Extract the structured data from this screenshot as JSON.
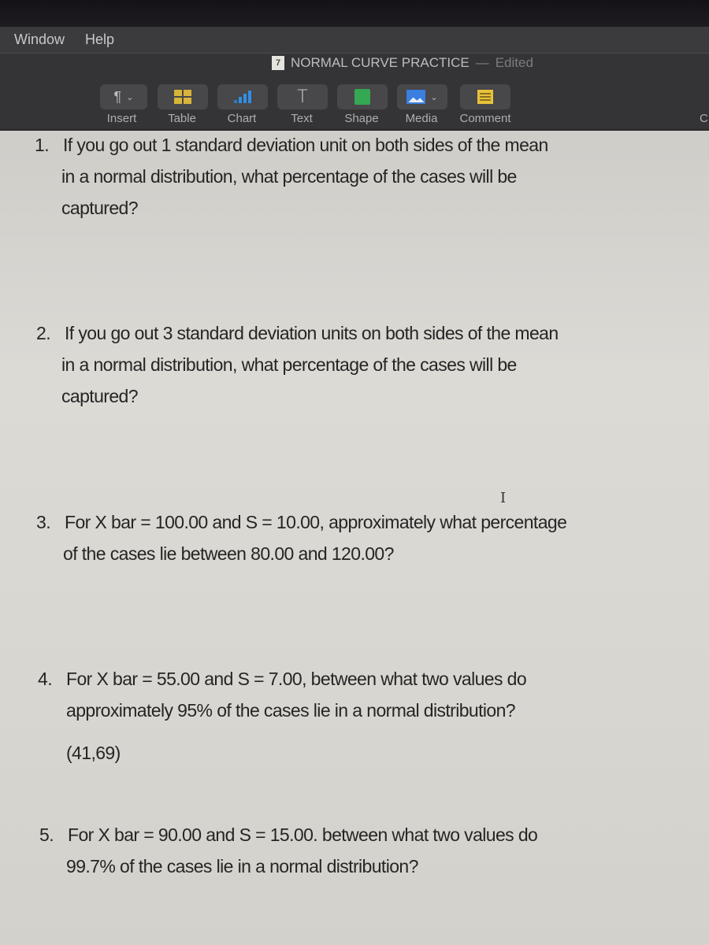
{
  "menubar": {
    "items": [
      "Window",
      "Help"
    ]
  },
  "window": {
    "title": "NORMAL CURVE PRACTICE",
    "separator": "—",
    "status": "Edited",
    "doc_icon_glyph": "7"
  },
  "toolbar": {
    "tools": [
      {
        "label": "Insert",
        "icon": "pilcrow-icon",
        "has_menu": true
      },
      {
        "label": "Table",
        "icon": "table-icon"
      },
      {
        "label": "Chart",
        "icon": "chart-icon"
      },
      {
        "label": "Text",
        "icon": "text-icon"
      },
      {
        "label": "Shape",
        "icon": "shape-icon"
      },
      {
        "label": "Media",
        "icon": "media-icon",
        "has_menu": true
      },
      {
        "label": "Comment",
        "icon": "comment-icon"
      }
    ],
    "right_cut_label": "C",
    "pilcrow_glyph": "¶",
    "chevron_glyph": "⌄",
    "text_glyph": "T"
  },
  "questions": [
    {
      "number": "1.",
      "lines": [
        "If you go out 1 standard deviation unit on both sides of the mean",
        "in a normal distribution, what percentage of the cases will be",
        "captured?"
      ]
    },
    {
      "number": "2.",
      "lines": [
        "If you go out 3 standard deviation units on both sides of the mean",
        "in a normal distribution, what percentage of the cases will be",
        "captured?"
      ]
    },
    {
      "number": "3.",
      "lines": [
        "For X bar = 100.00 and S = 10.00, approximately what percentage",
        "of the cases lie between 80.00 and 120.00?"
      ]
    },
    {
      "number": "4.",
      "lines": [
        "For X bar = 55.00 and S = 7.00, between what two values do",
        "approximately 95% of the cases lie in a normal distribution?"
      ],
      "answer": "(41,69)"
    },
    {
      "number": "5.",
      "lines": [
        "For X bar = 90.00 and S = 15.00. between what two values do",
        "99.7% of the cases lie in a normal distribution?"
      ]
    }
  ],
  "cursor_glyph": "I"
}
